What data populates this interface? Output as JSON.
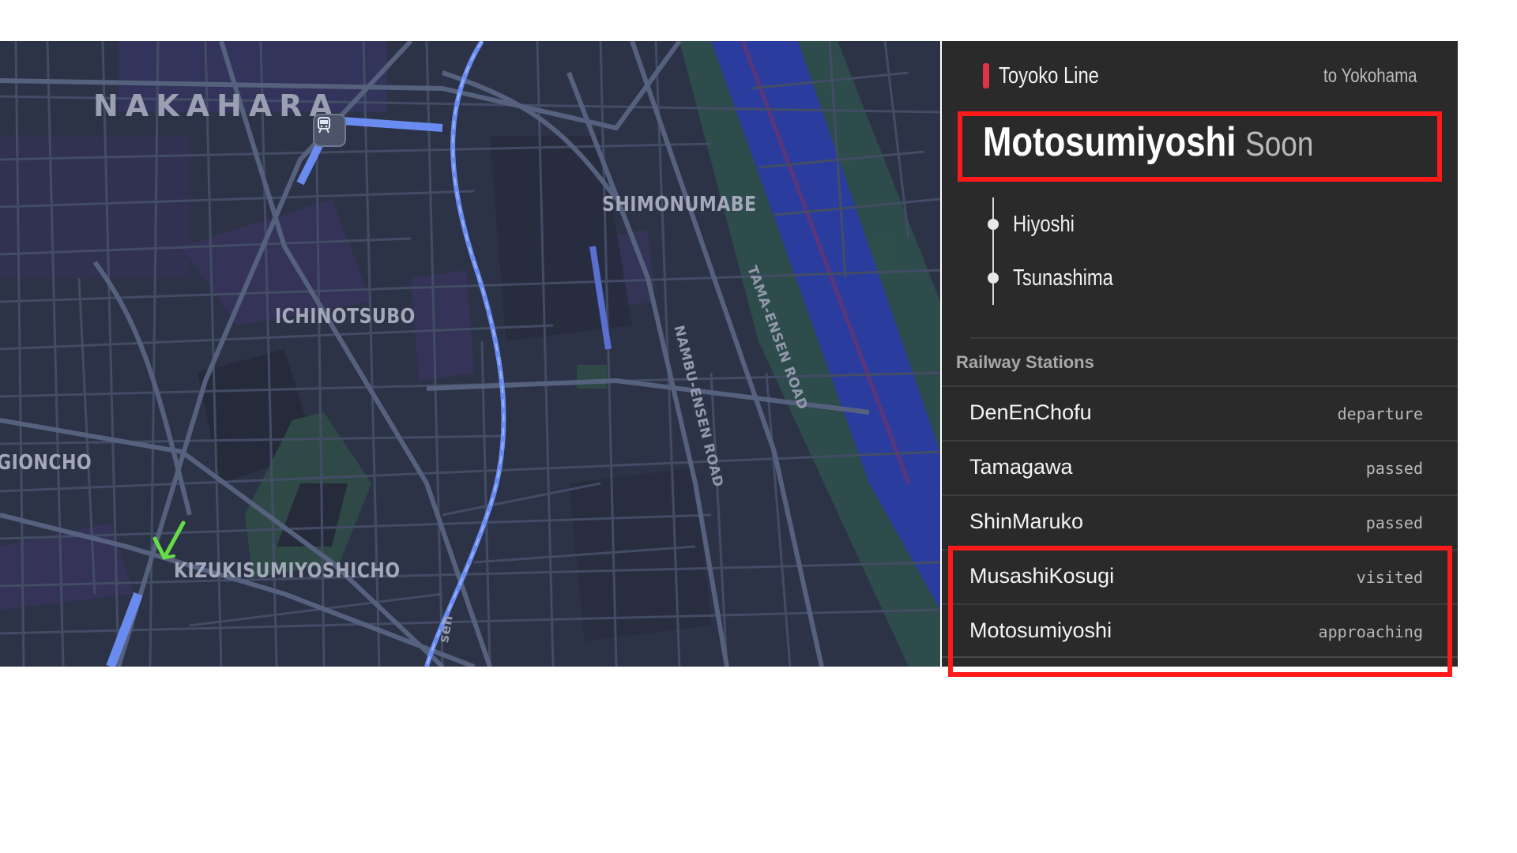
{
  "map": {
    "labels": {
      "nakahara": "NAKAHARA",
      "shimonumabe": "SHIMONUMABE",
      "ichinotsubo": "ICHINOTSUBO",
      "gioncho": "GIONCHO",
      "kizukisumiyoshicho": "KIZUKISUMIYOSHICHO",
      "nambu_ensen_road": "NAMBU-ENSEN ROAD",
      "tama_ensen_road": "TAMA-ENSEN ROAD",
      "partial_road": "sen"
    },
    "colors": {
      "background": "#2d3346",
      "road": "#46506a",
      "major_road": "#515c78",
      "rail": "#6a8cf0",
      "river": "#2a3d9e",
      "park": "#2f4a46",
      "district": "#3b3462",
      "cursor": "#66dd44"
    },
    "icons": {
      "transit": "train-station-icon",
      "cursor": "checkmark-cursor-icon"
    }
  },
  "panel": {
    "line": {
      "name": "Toyoko Line",
      "direction": "to Yokohama",
      "color": "#e0324b"
    },
    "next_station": {
      "name": "Motosumiyoshi",
      "eta": "Soon"
    },
    "upcoming_stops": [
      {
        "name": "Hiyoshi"
      },
      {
        "name": "Tsunashima"
      }
    ],
    "section_title": "Railway Stations",
    "stations": [
      {
        "name": "DenEnChofu",
        "status": "departure"
      },
      {
        "name": "Tamagawa",
        "status": "passed"
      },
      {
        "name": "ShinMaruko",
        "status": "passed"
      },
      {
        "name": "MusashiKosugi",
        "status": "visited"
      },
      {
        "name": "Motosumiyoshi",
        "status": "approaching"
      }
    ]
  },
  "annotations": {
    "highlight_color": "#ff1a1a"
  }
}
